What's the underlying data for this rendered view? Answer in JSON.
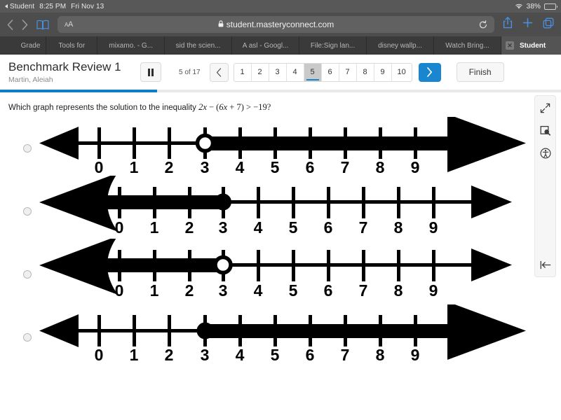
{
  "statusbar": {
    "back_app": "Student",
    "time": "8:25 PM",
    "date": "Fri Nov 13",
    "wifi_icon": "wifi-icon",
    "battery_percent": "38%",
    "battery_icon": "battery-icon"
  },
  "safari": {
    "back_icon": "chevron-left-icon",
    "forward_icon": "chevron-right-icon",
    "bookmarks_icon": "book-icon",
    "reader_label": "AA",
    "lock_icon": "lock-icon",
    "url": "student.masteryconnect.com",
    "reload_icon": "reload-icon",
    "share_icon": "share-icon",
    "newtab_icon": "plus-icon",
    "tabs_icon": "tabs-icon"
  },
  "tabs": [
    {
      "label": "Grade",
      "active": false
    },
    {
      "label": "Tools for",
      "active": false
    },
    {
      "label": "mixamo. - G...",
      "active": false
    },
    {
      "label": "sid the scien...",
      "active": false
    },
    {
      "label": "A asl - Googl...",
      "active": false
    },
    {
      "label": "File:Sign lan...",
      "active": false
    },
    {
      "label": "disney wallp...",
      "active": false
    },
    {
      "label": "Watch Bring...",
      "active": false
    },
    {
      "label": "Student",
      "active": true,
      "close_icon": "close-icon"
    }
  ],
  "header": {
    "quiz_title": "Benchmark Review 1",
    "student_name": "Martin, Aleiah",
    "pause_icon": "pause-icon",
    "question_count": "5 of 17",
    "prev_icon": "chevron-left-icon",
    "next_icon": "chevron-right-icon",
    "finish_label": "Finish",
    "pages": [
      "1",
      "2",
      "3",
      "4",
      "5",
      "6",
      "7",
      "8",
      "9",
      "10"
    ],
    "current_page": "5",
    "progress_percent": 28,
    "accent_color": "#1a86d0",
    "progress_color": "#0d7dc4"
  },
  "question": {
    "prefix": "Which graph represents the solution to the inequality ",
    "expression": "2x − (6x + 7) > −19?",
    "expr_parts": {
      "a": "2x",
      "b": " − (",
      "c": "6x",
      "d": " + 7) > −19?"
    }
  },
  "options": [
    {
      "id": "option-a",
      "selected": false,
      "labels": [
        "0",
        "1",
        "2",
        "3",
        "4",
        "5",
        "6",
        "7",
        "8",
        "9"
      ],
      "circle_at": "3",
      "circle_type": "open",
      "shade_direction": "right",
      "big_arrow_side": "right"
    },
    {
      "id": "option-b",
      "selected": false,
      "labels": [
        "0",
        "1",
        "2",
        "3",
        "4",
        "5",
        "6",
        "7",
        "8",
        "9"
      ],
      "circle_at": "3",
      "circle_type": "closed",
      "shade_direction": "left",
      "big_arrow_side": "left"
    },
    {
      "id": "option-c",
      "selected": false,
      "labels": [
        "0",
        "1",
        "2",
        "3",
        "4",
        "5",
        "6",
        "7",
        "8",
        "9"
      ],
      "circle_at": "3",
      "circle_type": "open",
      "shade_direction": "left",
      "big_arrow_side": "left"
    },
    {
      "id": "option-d",
      "selected": false,
      "labels": [
        "0",
        "1",
        "2",
        "3",
        "4",
        "5",
        "6",
        "7",
        "8",
        "9"
      ],
      "circle_at": "3",
      "circle_type": "closed",
      "shade_direction": "right",
      "big_arrow_side": "right"
    }
  ],
  "sidebar": {
    "tools": [
      {
        "icon": "expand-arrows-icon"
      },
      {
        "icon": "magnifier-tool-icon"
      },
      {
        "icon": "accessibility-icon"
      }
    ],
    "collapse_icon": "collapse-left-icon"
  }
}
